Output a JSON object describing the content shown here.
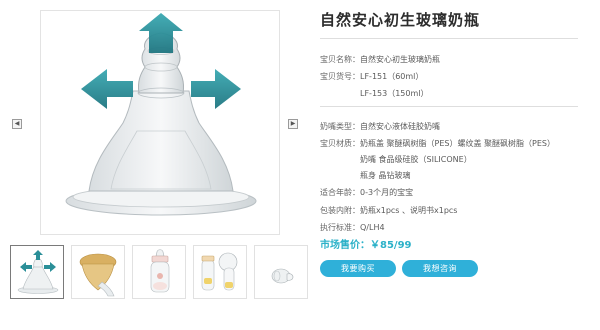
{
  "product": {
    "title": "自然安心初生玻璃奶瓶"
  },
  "details": {
    "name_label": "宝贝名称：",
    "name_value": "自然安心初生玻璃奶瓶",
    "sku_label": "宝贝货号：",
    "sku_values": [
      "LF-151（60ml）",
      "LF-153（150ml）"
    ],
    "nipple_type_label": "奶嘴类型：",
    "nipple_type_value": "自然安心液体硅胶奶嘴",
    "material_label": "宝贝材质：",
    "material_values": [
      "奶瓶盖 聚醚砜树脂（PES）螺纹盖 聚醚砜树脂（PES）",
      "奶嘴 食品级硅胶（SILICONE）",
      "瓶身 晶钻玻璃"
    ],
    "age_label": "适合年龄：",
    "age_value": "0-3个月的宝宝",
    "package_label": "包装内附：",
    "package_value": "奶瓶x1pcs 、说明书x1pcs",
    "standard_label": "执行标准：",
    "standard_value": "Q/LH4"
  },
  "price": {
    "label": "市场售价：",
    "value": "￥85/99"
  },
  "buttons": {
    "buy": "我要购买",
    "ask": "我想咨询"
  },
  "gallery": {
    "prev": "◀",
    "next": "▶",
    "thumbnails": [
      "nipple-arrows",
      "nipple-gold",
      "bottle-small",
      "bottle-pump",
      "nipple-side"
    ],
    "active_index": 0
  },
  "colors": {
    "accent": "#2fb0d9",
    "price": "#2bb1c8",
    "arrow_teal": "#2b8f98"
  }
}
